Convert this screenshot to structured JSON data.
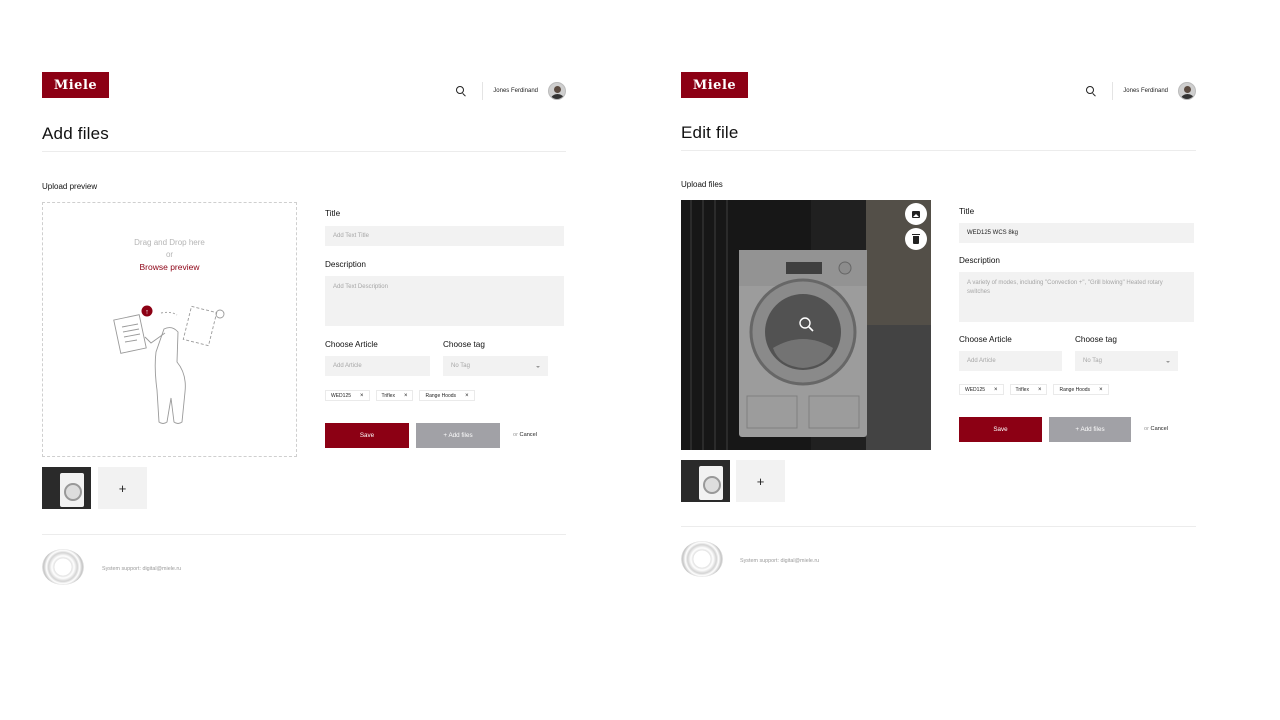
{
  "brand": {
    "logo_text": "Miele",
    "accent": "#8c0014"
  },
  "header": {
    "user_name": "Jones Ferdinand",
    "search_icon": "search-icon"
  },
  "add_screen": {
    "title": "Add files",
    "upload_label": "Upload preview",
    "dropzone": {
      "line1": "Drag and Drop here",
      "line2": "or",
      "link": "Browse preview"
    },
    "fields": {
      "title_label": "Title",
      "title_placeholder": "Add Text Title",
      "description_label": "Description",
      "description_placeholder": "Add Text Description",
      "article_label": "Choose Article",
      "article_placeholder": "Add Article",
      "tag_label": "Choose tag",
      "tag_value": "No Tag"
    },
    "tags": [
      "WED125",
      "Triflex",
      "Range Hoods"
    ],
    "buttons": {
      "save": "Save",
      "add_files": "+ Add files",
      "or": "or",
      "cancel": "Cancel"
    },
    "add_thumb": "+"
  },
  "edit_screen": {
    "title": "Edit file",
    "upload_label": "Upload files",
    "fields": {
      "title_label": "Title",
      "title_value": "WED125 WCS 8kg",
      "description_label": "Description",
      "description_value": "A variety of modes, including \"Convection +\", \"Grill blowing\" Heated rotary switches",
      "article_label": "Choose Article",
      "article_placeholder": "Add Article",
      "tag_label": "Choose tag",
      "tag_value": "No Tag"
    },
    "tags": [
      "WED125",
      "Triflex",
      "Range Hoods"
    ],
    "buttons": {
      "save": "Save",
      "add_files": "+ Add files",
      "or": "or",
      "cancel": "Cancel"
    },
    "add_thumb": "+"
  },
  "footer": {
    "support": "System support: digital@miele.ru"
  }
}
